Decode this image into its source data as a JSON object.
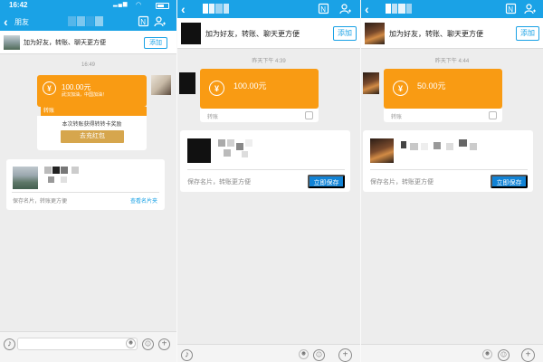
{
  "colors": {
    "accent": "#1aa2e6",
    "transfer_orange": "#f99b13",
    "gold_button": "#d6a64d",
    "save_blue": "#1183d6",
    "chat_bg": "#ededed"
  },
  "panel1": {
    "status": {
      "time": "16:42"
    },
    "nav": {
      "back_label": "朋友",
      "icons": [
        "card-icon",
        "add-person-icon"
      ]
    },
    "banner": {
      "text": "加为好友，转账、聊天更方便",
      "button": "添加"
    },
    "timestamp": "16:49",
    "transfer": {
      "amount": "100.00元",
      "note": "武汉加油，中国加油！",
      "footer_label": "转账"
    },
    "promo": {
      "text": "本次转账获得转转卡奖励",
      "button": "去充红包"
    },
    "contact": {
      "save_text": "保存名片，转账更方便",
      "link": "查看名片夹"
    }
  },
  "panel2": {
    "nav": {
      "icons": [
        "card-icon",
        "add-person-icon"
      ]
    },
    "banner": {
      "text": "加为好友，转账、聊天更方便",
      "button": "添加"
    },
    "timestamp": "昨天下午 4:39",
    "transfer": {
      "amount": "100.00元",
      "footer_label": "转账"
    },
    "contact": {
      "save_text": "保存名片，转账更方便",
      "button": "立即保存"
    }
  },
  "panel3": {
    "nav": {
      "icons": [
        "card-icon",
        "add-person-icon"
      ]
    },
    "banner": {
      "text": "加为好友，转账、聊天更方便",
      "button": "添加"
    },
    "timestamp": "昨天下午 4:44",
    "transfer": {
      "amount": "50.00元",
      "footer_label": "转账"
    },
    "contact": {
      "save_text": "保存名片，转账更方便",
      "button": "立即保存"
    }
  }
}
